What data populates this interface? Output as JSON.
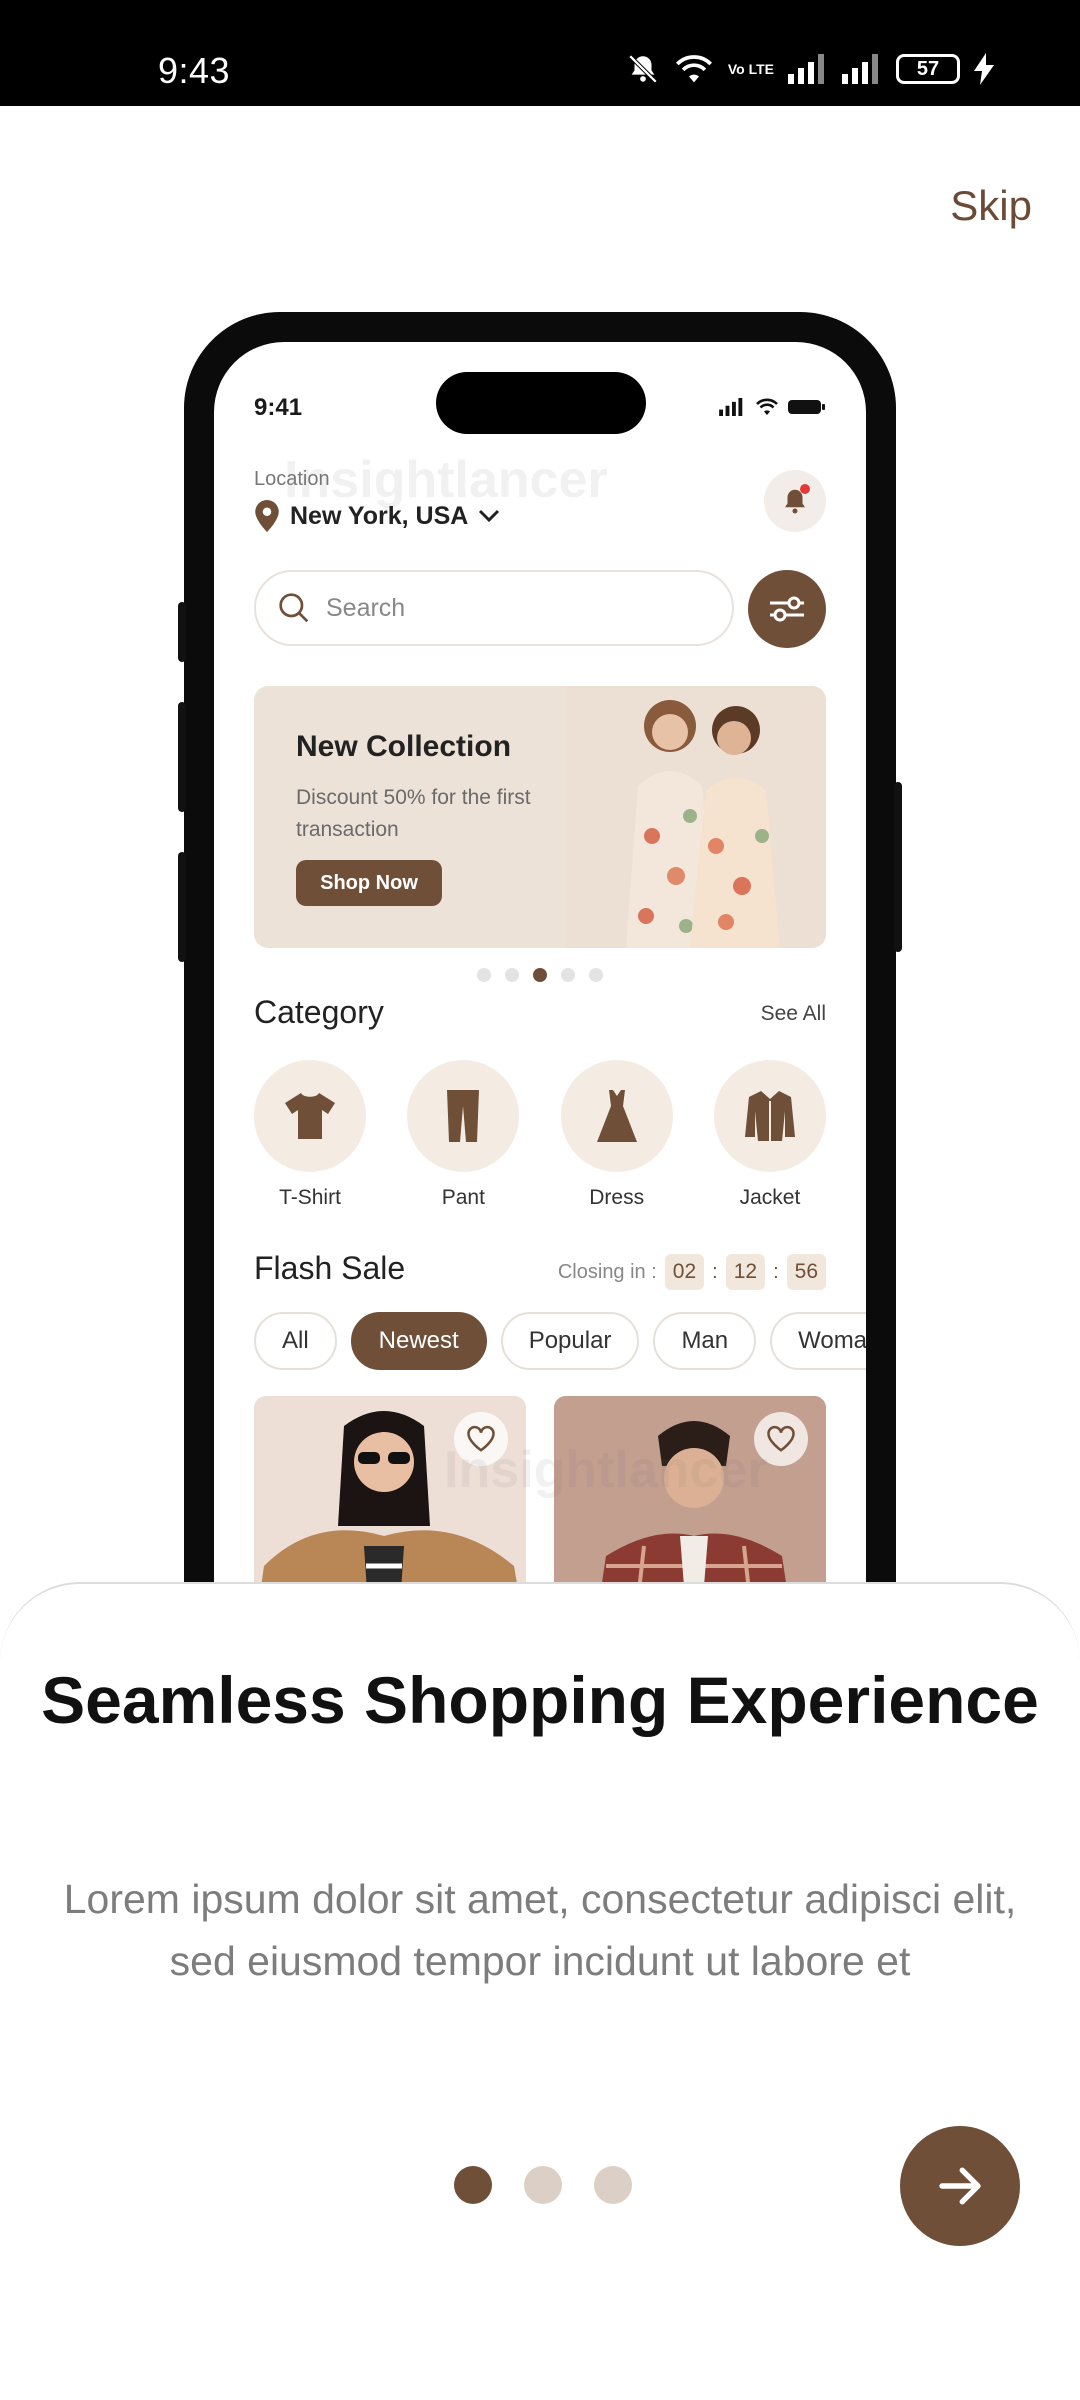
{
  "status_bar": {
    "time": "9:43",
    "battery": "57",
    "network": "Vo LTE"
  },
  "skip_label": "Skip",
  "mockup": {
    "time": "9:41",
    "location_label": "Location",
    "location_value": "New York, USA",
    "search_placeholder": "Search",
    "banner": {
      "title": "New Collection",
      "subtitle": "Discount 50% for the first transaction",
      "button": "Shop Now"
    },
    "banner_dots": {
      "count": 5,
      "active": 3
    },
    "category": {
      "title": "Category",
      "see_all": "See All",
      "items": [
        {
          "label": "T-Shirt",
          "icon": "tshirt-icon"
        },
        {
          "label": "Pant",
          "icon": "pant-icon"
        },
        {
          "label": "Dress",
          "icon": "dress-icon"
        },
        {
          "label": "Jacket",
          "icon": "jacket-icon"
        }
      ]
    },
    "flash_sale": {
      "title": "Flash Sale",
      "closing_label": "Closing in :",
      "timer": [
        "02",
        "12",
        "56"
      ],
      "chips": [
        "All",
        "Newest",
        "Popular",
        "Man",
        "Woman"
      ],
      "active_chip": "Newest"
    },
    "watermark": "Insightlancer"
  },
  "onboarding": {
    "title": "Seamless Shopping Experience",
    "description": "Lorem ipsum dolor sit amet, consectetur adipisci elit, sed eiusmod tempor incidunt ut labore et",
    "page_dots": {
      "count": 3,
      "active": 1
    }
  },
  "colors": {
    "accent": "#704f38",
    "dot_inactive": "#dccfc6",
    "banner_bg": "#ede2d8"
  }
}
